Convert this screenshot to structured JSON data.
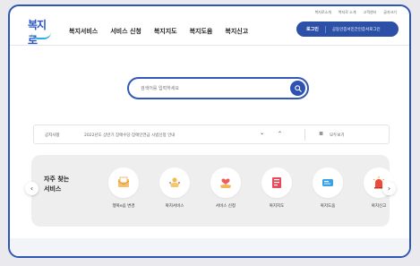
{
  "utility_links": [
    "복지로소개",
    "복지로 소개",
    "고객센터",
    "글자크기"
  ],
  "logo": {
    "text": "복지로"
  },
  "nav": {
    "items": [
      "복지서비스",
      "서비스 신청",
      "복지지도",
      "복지도움",
      "복지신고"
    ]
  },
  "account": {
    "login_label": "로그인",
    "cert_label": "공동인증서민간인증서로그인"
  },
  "search": {
    "placeholder": "검색어를 입력하세요",
    "icon": "search-icon"
  },
  "notice": {
    "label": "공지사항",
    "text": "2022년도 상반기 장애수당·장애인연금 시범신청 안내",
    "link_label": "모두보기"
  },
  "services": {
    "title_line1": "자주 찾는",
    "title_line2": "서비스",
    "items": [
      {
        "label": "행복e음 변경",
        "icon": "document-envelope-icon",
        "color": "#f2a84a"
      },
      {
        "label": "복지서비스",
        "icon": "person-hands-icon",
        "color": "#f2b84a"
      },
      {
        "label": "서비스 신청",
        "icon": "hands-heart-icon",
        "color": "#f59a4a"
      },
      {
        "label": "복지지도",
        "icon": "map-document-icon",
        "color": "#e94a5a"
      },
      {
        "label": "복지도움",
        "icon": "chat-card-icon",
        "color": "#3aa3e8"
      },
      {
        "label": "복지신고",
        "icon": "siren-icon",
        "color": "#ee4a3a"
      }
    ]
  },
  "colors": {
    "primary": "#2c4fa8",
    "frame_border": "#2f56b6"
  }
}
